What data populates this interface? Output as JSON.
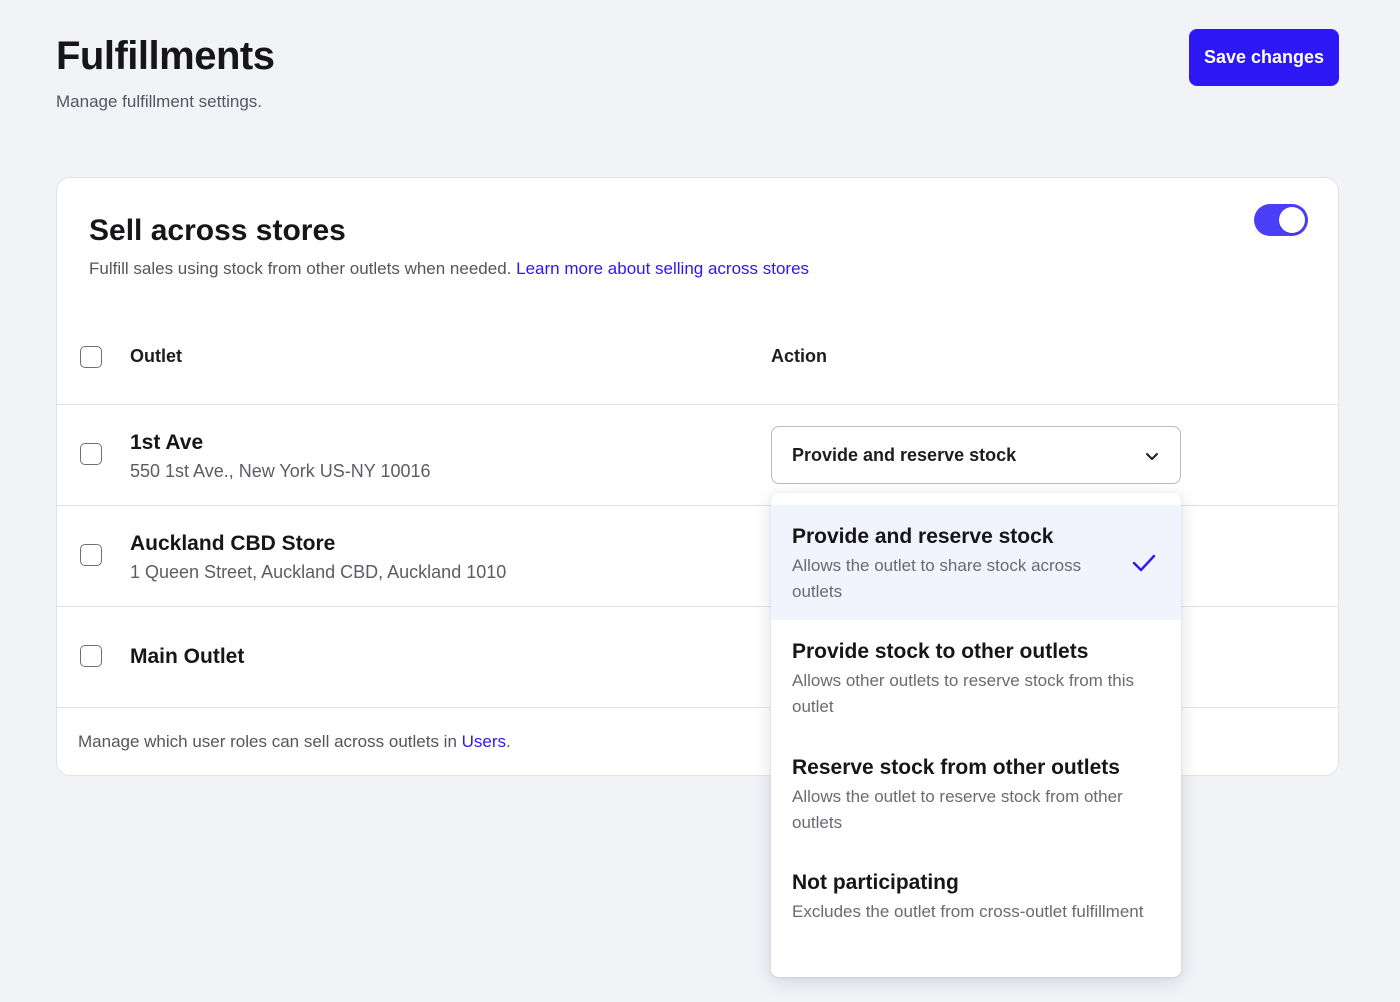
{
  "header": {
    "title": "Fulfillments",
    "subtitle": "Manage fulfillment settings.",
    "save_label": "Save changes"
  },
  "card": {
    "title": "Sell across stores",
    "description": "Fulfill sales using stock from other outlets when needed.",
    "learn_more_link": "Learn more about selling across stores",
    "toggle_on": true,
    "columns": {
      "outlet": "Outlet",
      "action": "Action"
    },
    "rows": [
      {
        "name": "1st Ave",
        "address": "550 1st Ave., New York US-NY 10016"
      },
      {
        "name": "Auckland CBD Store",
        "address": "1 Queen Street, Auckland CBD, Auckland 1010"
      },
      {
        "name": "Main Outlet",
        "address": ""
      }
    ],
    "action_select": {
      "value": "Provide and reserve stock"
    },
    "footer_text": "Manage which user roles can sell across outlets in",
    "footer_link": "Users",
    "footer_suffix": "."
  },
  "dropdown": {
    "options": [
      {
        "title": "Provide and reserve stock",
        "description": "Allows the outlet to share stock across outlets",
        "selected": true
      },
      {
        "title": "Provide stock to other outlets",
        "description": "Allows other outlets to reserve stock from this outlet",
        "selected": false
      },
      {
        "title": "Reserve stock from other outlets",
        "description": "Allows the outlet to reserve stock from other outlets",
        "selected": false
      },
      {
        "title": "Not participating",
        "description": "Excludes the outlet from cross-outlet fulfillment",
        "selected": false
      }
    ]
  },
  "colors": {
    "accent": "#2d17f5",
    "toggle": "#4b3ef7",
    "selected_bg": "#f1f3fd",
    "background": "#f2f3f7"
  },
  "icons": {
    "chevron": "chevron-down-icon",
    "check": "checkmark-icon"
  }
}
